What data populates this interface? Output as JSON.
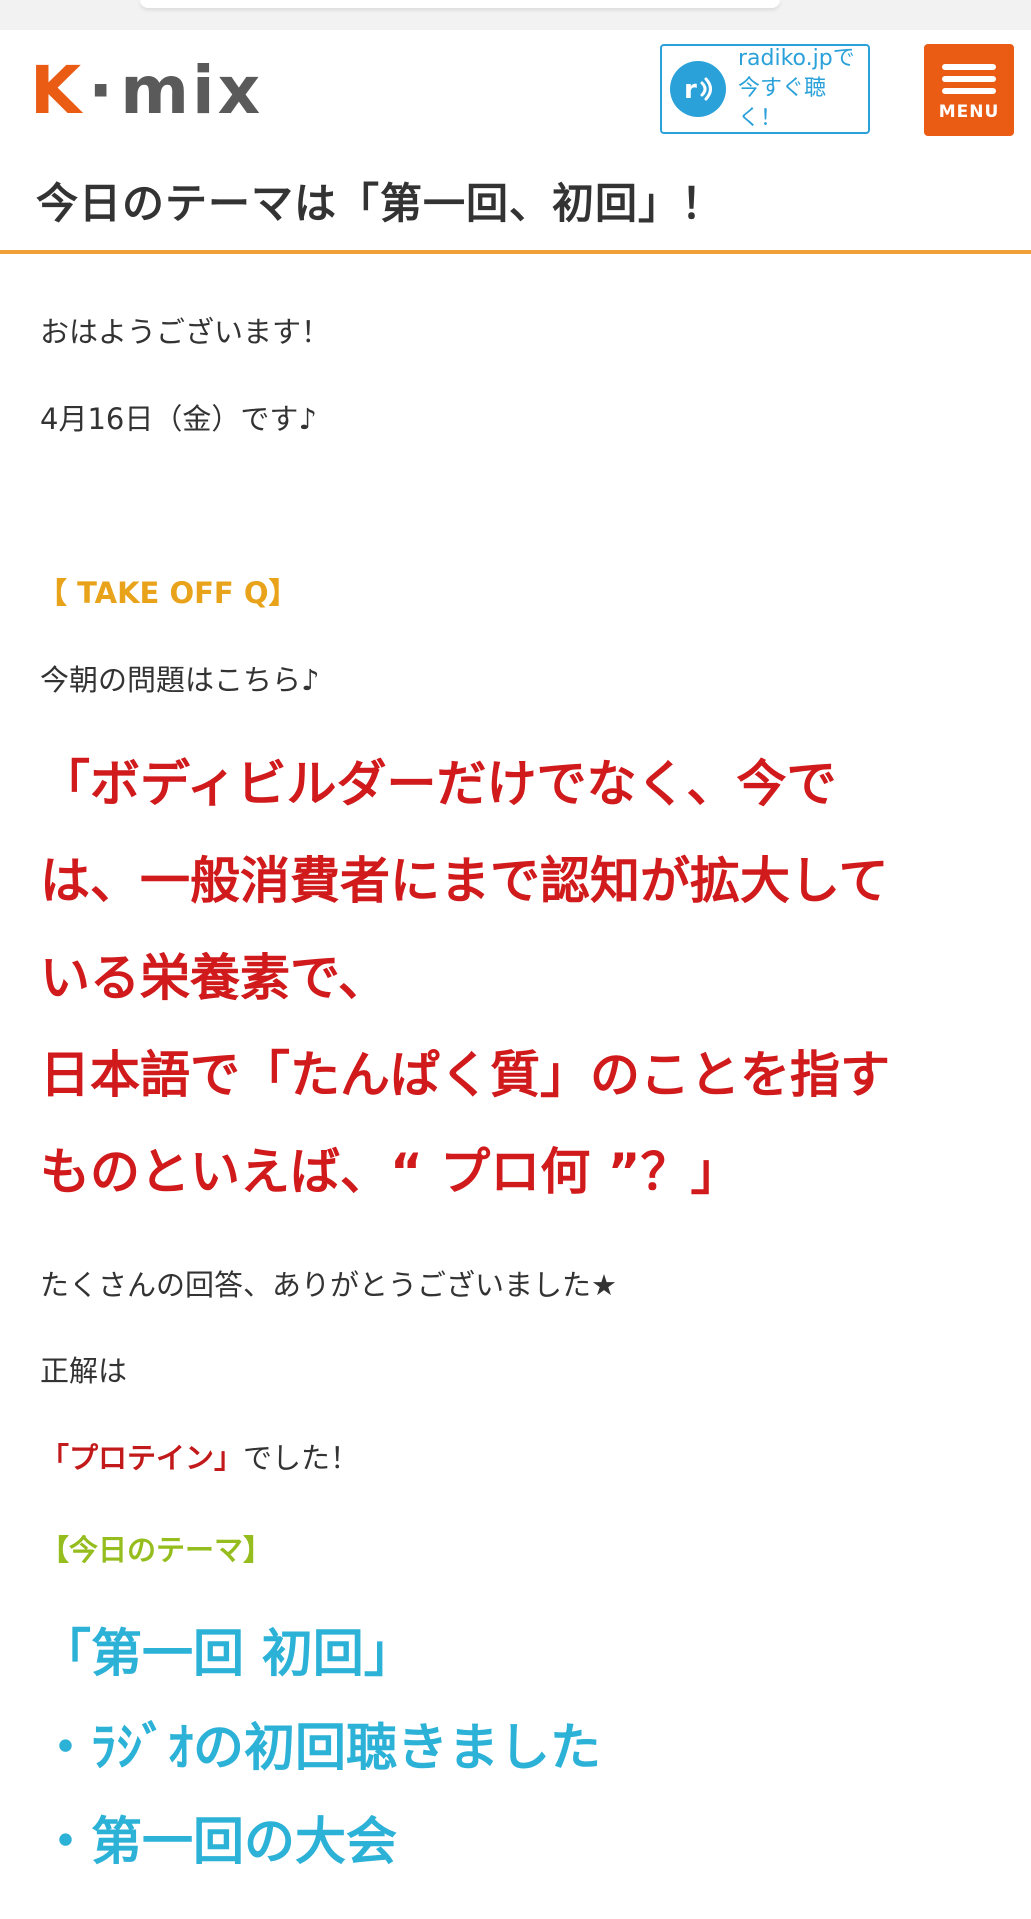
{
  "header": {
    "logo": {
      "k": "K",
      "dot": "·",
      "rest": "mix"
    },
    "radiko": {
      "line1": "radiko.jpで",
      "line2": "今すぐ聴く！"
    },
    "menu_label": "MENU"
  },
  "page_title": "今日のテーマは「第一回、初回」！",
  "article": {
    "greeting": "おはようございます！",
    "date": "4月16日（金）です♪",
    "takeoff_label": "【 TAKE OFF Q】",
    "question_intro": "今朝の問題はこちら♪",
    "question_lines": [
      "「ボディビルダーだけでなく、今で",
      "は、一般消費者にまで認知が拡大して",
      "いる栄養素で、",
      "日本語で「たんぱく質」のことを指す",
      "ものといえば、“ プロ何 ”？」"
    ],
    "thanks": "たくさんの回答、ありがとうございました★",
    "answer_intro": "正解は",
    "answer": "「プロテイン」",
    "answer_suffix": "でした！",
    "theme_label": "【今日のテーマ】",
    "theme_title": "「第一回 初回」",
    "theme_items": [
      "・ﾗｼﾞｵの初回聴きました",
      "・第一回の大会"
    ]
  },
  "colors": {
    "brand_orange": "#ea5b14",
    "radiko_blue": "#2aa1d9",
    "underline": "#f0a036",
    "question_red": "#d01a1c",
    "label_orange": "#e8a31b",
    "label_green": "#96bd1e",
    "theme_teal": "#2cb1d7"
  },
  "icons": {
    "radiko": "radiko-icon",
    "menu": "hamburger-icon"
  }
}
